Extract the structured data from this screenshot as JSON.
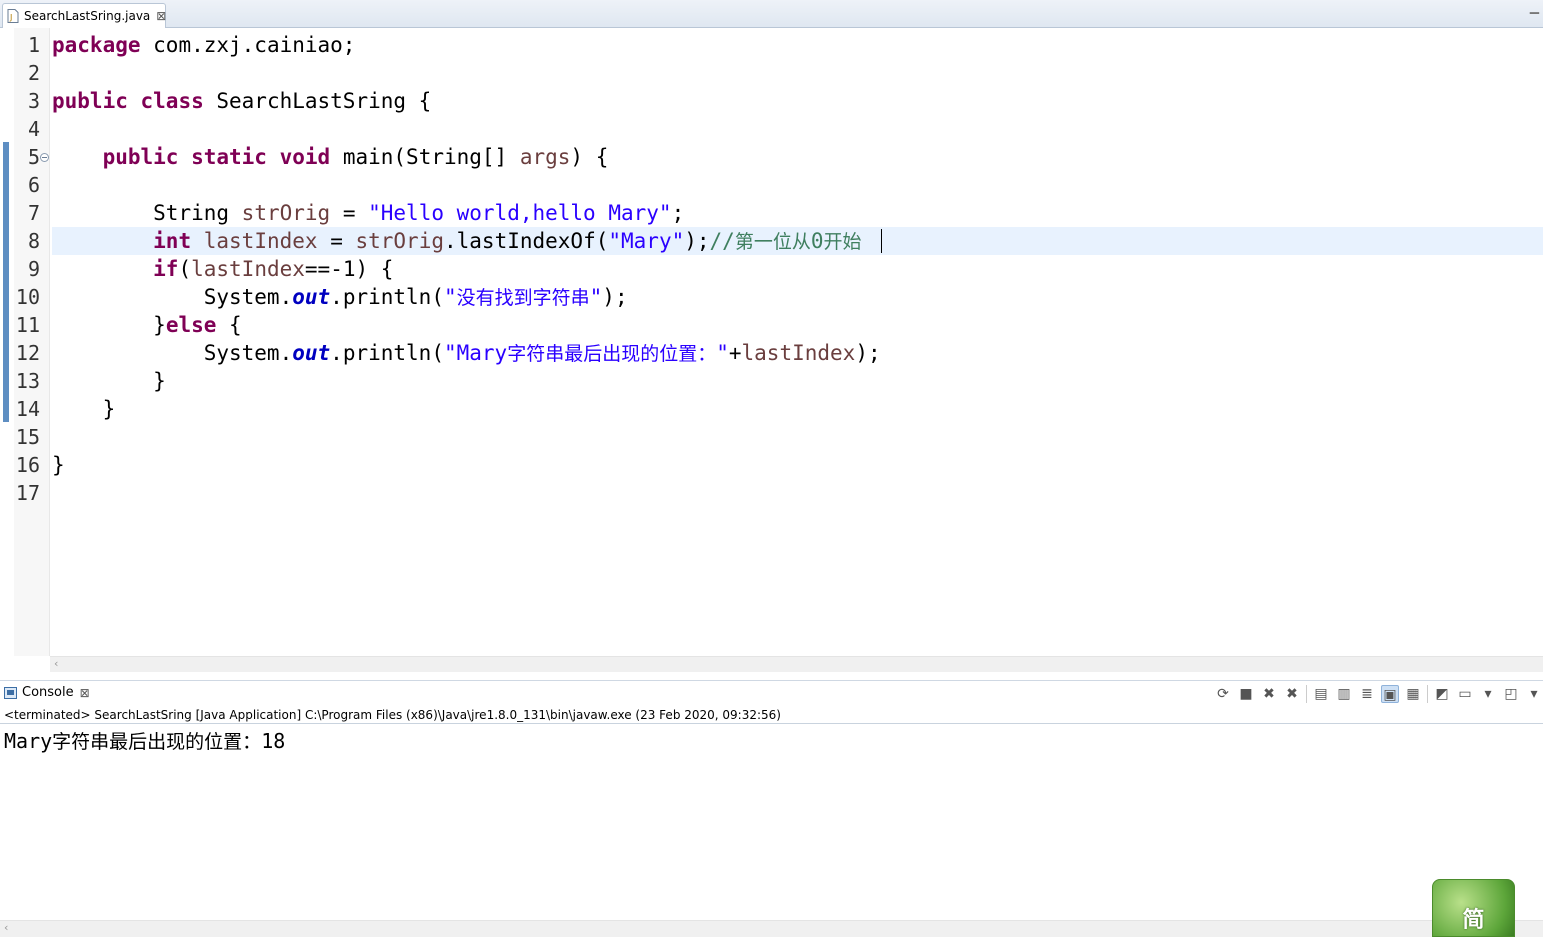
{
  "editor": {
    "tab_label": "SearchLastSring.java",
    "tab_close": "⊠",
    "line_numbers": [
      "1",
      "2",
      "3",
      "4",
      "5",
      "6",
      "7",
      "8",
      "9",
      "10",
      "11",
      "12",
      "13",
      "14",
      "15",
      "16",
      "17"
    ]
  },
  "code": {
    "line1": {
      "kw": "package",
      "rest": " com.zxj.cainiao;"
    },
    "line3": {
      "kw1": "public",
      "kw2": "class",
      "rest": " SearchLastSring {"
    },
    "line5": {
      "indent": "    ",
      "kw1": "public",
      "kw2": "static",
      "kw3": "void",
      "rest1": " main(String[] ",
      "var": "args",
      "rest2": ") {"
    },
    "line7": {
      "indent": "        ",
      "type": "String ",
      "var": "strOrig",
      "eq": " = ",
      "str": "\"Hello world,hello Mary\"",
      "end": ";"
    },
    "line8": {
      "indent": "        ",
      "kw": "int",
      "sp": " ",
      "var1": "lastIndex",
      "eq": " = ",
      "var2": "strOrig",
      "call": ".lastIndexOf(",
      "str": "\"Mary\"",
      "end": ");",
      "cmt1": "//",
      "cmt2": "第一位从",
      "cmt3": "0",
      "cmt4": "开始"
    },
    "line9": {
      "indent": "        ",
      "kw": "if",
      "open": "(",
      "var": "lastIndex",
      "rest": "==-1) {"
    },
    "line10": {
      "indent": "            ",
      "sys": "System.",
      "fld": "out",
      "call": ".println(",
      "str1": "\"",
      "str2": "没有找到字符串",
      "str3": "\"",
      "end": ");"
    },
    "line11": {
      "indent": "        ",
      "brace": "}",
      "kw": "else",
      "rest": " {"
    },
    "line12": {
      "indent": "            ",
      "sys": "System.",
      "fld": "out",
      "call": ".println(",
      "str1": "\"Mary",
      "str2": "字符串最后出现的位置：",
      "str3": "\"",
      "plus": "+",
      "var": "lastIndex",
      "end": ");"
    },
    "line13": {
      "text": "        }"
    },
    "line14": {
      "text": "    }"
    },
    "line16": {
      "text": "}"
    }
  },
  "console": {
    "tab_label": "Console",
    "tab_close": "⊠",
    "status": "<terminated> SearchLastSring [Java Application] C:\\Program Files (x86)\\Java\\jre1.8.0_131\\bin\\javaw.exe (23 Feb 2020, 09:32:56)",
    "output_en": "Mary",
    "output_cn": "字符串最后出现的位置：",
    "output_num": "18"
  },
  "ime": {
    "label": "简"
  }
}
